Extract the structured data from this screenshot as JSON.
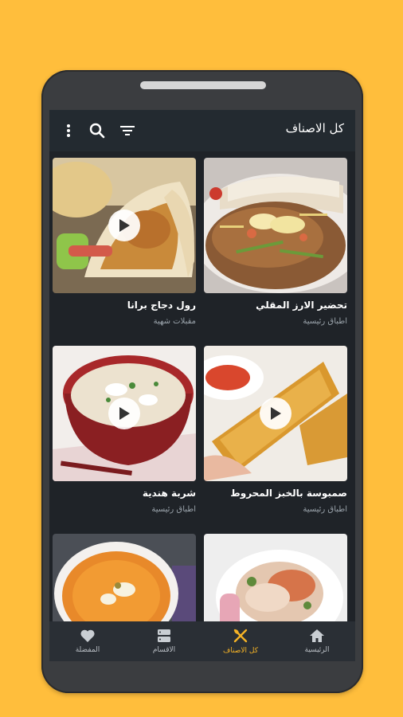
{
  "appbar": {
    "title": "كل الاصناف",
    "icons": [
      "filter-icon",
      "search-icon",
      "more-vert-icon"
    ]
  },
  "recipes": [
    {
      "name": "تحضير الارز المقلي",
      "category": "اطباق رئيسية",
      "has_video": false
    },
    {
      "name": "رول دجاج برانا",
      "category": "مقبلات شهية",
      "has_video": true
    },
    {
      "name": "صمبوسة بالخبز المحروط",
      "category": "اطباق رئيسية",
      "has_video": true
    },
    {
      "name": "شربة هندية",
      "category": "اطباق رئيسية",
      "has_video": true
    },
    {
      "name": "",
      "category": "",
      "has_video": false
    },
    {
      "name": "",
      "category": "",
      "has_video": false
    }
  ],
  "bottom_nav": [
    {
      "label": "الرئيسية",
      "icon": "home-icon",
      "active": false
    },
    {
      "label": "كل الاصناف",
      "icon": "cutlery-icon",
      "active": true
    },
    {
      "label": "الاقسام",
      "icon": "categories-icon",
      "active": false
    },
    {
      "label": "المفضلة",
      "icon": "heart-icon",
      "active": false
    }
  ],
  "colors": {
    "background": "#FFBE3C",
    "accent": "#F5B326",
    "screen": "#1F2328"
  }
}
